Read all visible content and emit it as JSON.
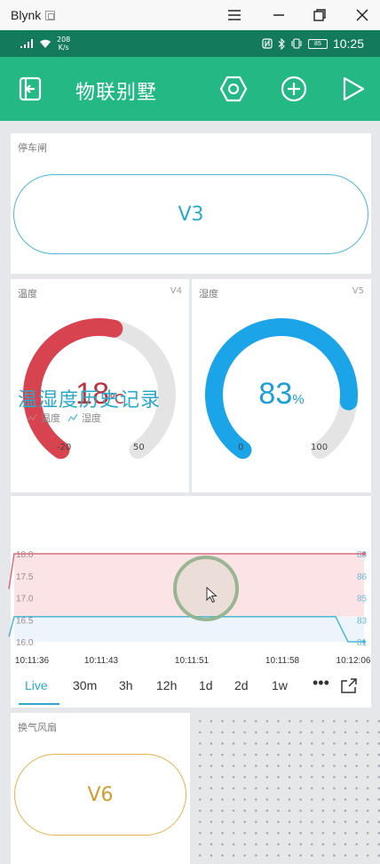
{
  "window": {
    "title": "Blynk"
  },
  "status_bar": {
    "speed_value": "208",
    "speed_unit": "K/s",
    "battery": "85",
    "time": "10:25"
  },
  "app": {
    "title": "物联别墅"
  },
  "parking": {
    "label": "停车闸",
    "button_label": "V3"
  },
  "temperature": {
    "label": "温度",
    "pin": "V4",
    "value": 18,
    "unit": "℃",
    "min": "-20",
    "max": "50",
    "color": "#d7434f"
  },
  "humidity": {
    "label": "湿度",
    "pin": "V5",
    "value": 83,
    "unit": "%",
    "min": "0",
    "max": "100",
    "color": "#1ba5e8"
  },
  "history": {
    "title": "温湿度历史记录",
    "legend": [
      "温度",
      "湿度"
    ],
    "time_ranges": [
      "Live",
      "30m",
      "3h",
      "12h",
      "1d",
      "2d",
      "1w"
    ],
    "active_range": "Live"
  },
  "chart_data": {
    "type": "line",
    "x": [
      "10:11:36",
      "10:11:43",
      "10:11:51",
      "10:11:58",
      "10:12:06"
    ],
    "series": [
      {
        "name": "温度",
        "axis": "left",
        "color": "#d66d7d",
        "values": [
          17.2,
          18.0,
          18.0,
          18.0,
          18.0
        ]
      },
      {
        "name": "湿度",
        "axis": "right",
        "color": "#4cb6d6",
        "values": [
          81.4,
          83.0,
          83.0,
          83.0,
          81.0
        ]
      }
    ],
    "left_ticks": [
      "18.0",
      "17.5",
      "17.0",
      "16.5",
      "16.0"
    ],
    "right_ticks": [
      "88",
      "86",
      "85",
      "83",
      "81"
    ],
    "ylim_left": [
      16.0,
      18.0
    ],
    "ylim_right": [
      81,
      88
    ],
    "x_tick_labels": [
      "10:11:36",
      "10:11:43",
      "10:11:51",
      "10:11:58",
      "10:12:06"
    ]
  },
  "fan": {
    "label": "换气风扇",
    "button_label": "V6"
  }
}
